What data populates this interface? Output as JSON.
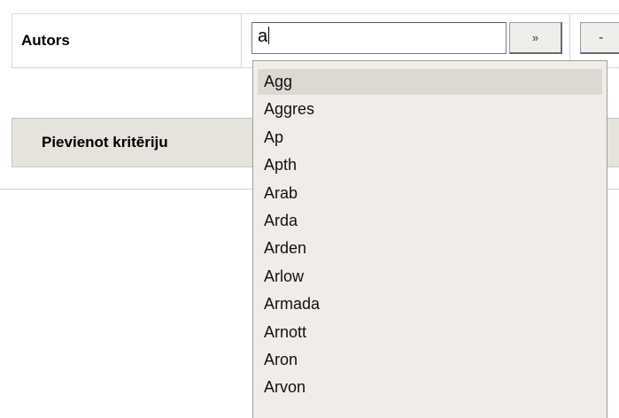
{
  "criteria": {
    "label": "Autors",
    "input_value": "a",
    "go_button": "»",
    "remove_button": "-"
  },
  "add_button": "Pievienot kritēriju",
  "suggestions": [
    {
      "label": "Agg",
      "selected": true
    },
    {
      "label": "Aggres"
    },
    {
      "label": "Ap"
    },
    {
      "label": "Apth"
    },
    {
      "label": "Arab"
    },
    {
      "label": "Arda"
    },
    {
      "label": "Arden"
    },
    {
      "label": "Arlow"
    },
    {
      "label": "Armada"
    },
    {
      "label": "Arnott"
    },
    {
      "label": "Aron"
    },
    {
      "label": "Arvon"
    }
  ]
}
